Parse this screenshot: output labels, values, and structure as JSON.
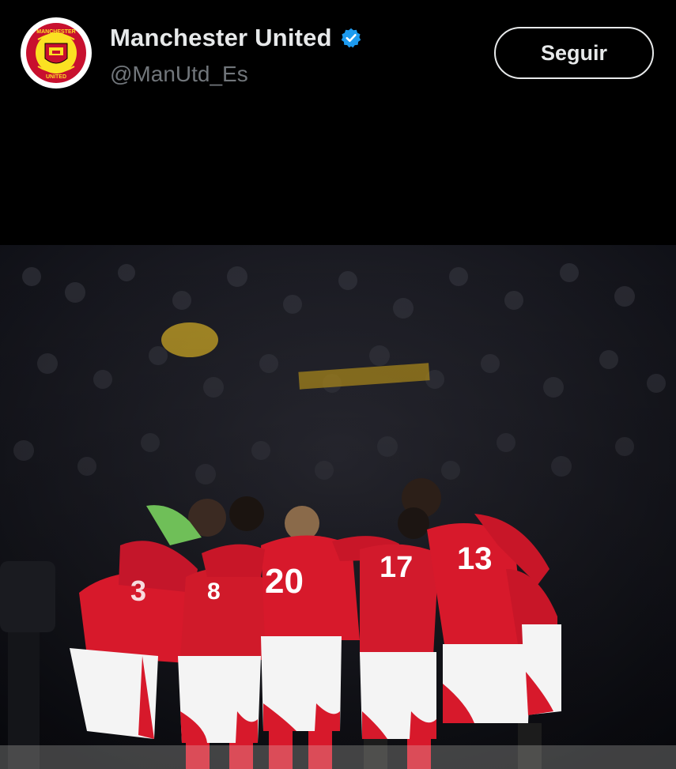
{
  "account": {
    "display_name": "Manchester United",
    "handle": "@ManUtd_Es",
    "verified": true,
    "avatar_icon": "manchester-united-crest",
    "avatar_logo_text": {
      "top": "MANCHESTER",
      "bottom": "UNITED"
    }
  },
  "follow_button": {
    "label": "Seguir"
  },
  "post_image": {
    "description_icon": "team-huddle-photo",
    "shirt_numbers": [
      "20",
      "17",
      "13",
      "8",
      "3"
    ]
  },
  "colors": {
    "background": "#000000",
    "text_primary": "#e7e9ea",
    "text_secondary": "#71767b",
    "verified_badge": "#1d9bf0",
    "kit_red": "#d7192b",
    "kit_white": "#f4f4f4"
  }
}
